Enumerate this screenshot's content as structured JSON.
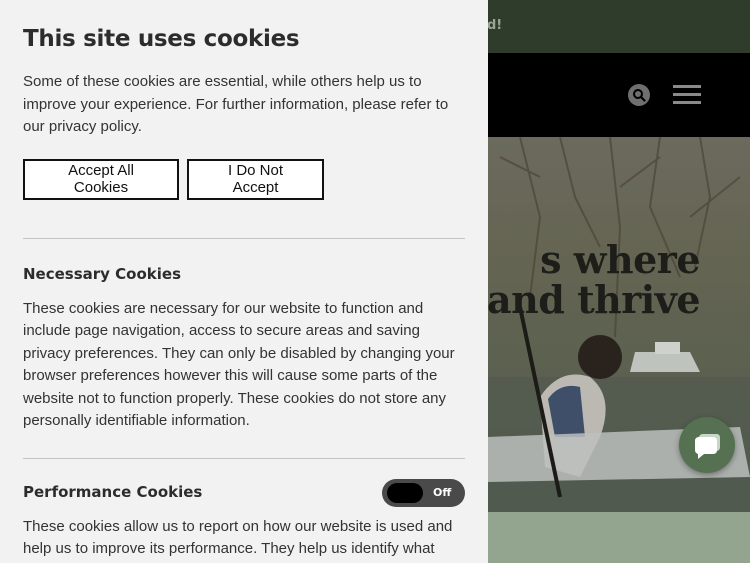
{
  "site": {
    "announcement": "d!",
    "hero_title_line1": "s where",
    "hero_title_line2": "and thrive"
  },
  "icons": {
    "search": "search-icon",
    "menu": "hamburger-menu-icon",
    "chat": "chat-bubble-icon"
  },
  "colors": {
    "announcement_bar": "#2f3c2c",
    "header": "#000000",
    "panel_background": "#f2f2f2",
    "chat_button": "#557152",
    "bottom_strip": "#93a48f"
  },
  "cookie_banner": {
    "title": "This site uses cookies",
    "intro": "Some of these cookies are essential, while others help us to improve your experience. For further information, please refer to our privacy policy.",
    "accept_label": "Accept All Cookies",
    "decline_label": "I Do Not Accept",
    "sections": [
      {
        "title": "Necessary Cookies",
        "description": "These cookies are necessary for our website to function and include page navigation, access to secure areas and saving privacy preferences. They can only be disabled by changing your browser preferences however this will cause some parts of the website not to function properly. These cookies do not store any personally identifiable information."
      },
      {
        "title": "Performance Cookies",
        "toggle_state": "Off",
        "description": "These cookies allow us to report on how our website is used and help us to improve its performance. They help us identify what"
      }
    ]
  }
}
